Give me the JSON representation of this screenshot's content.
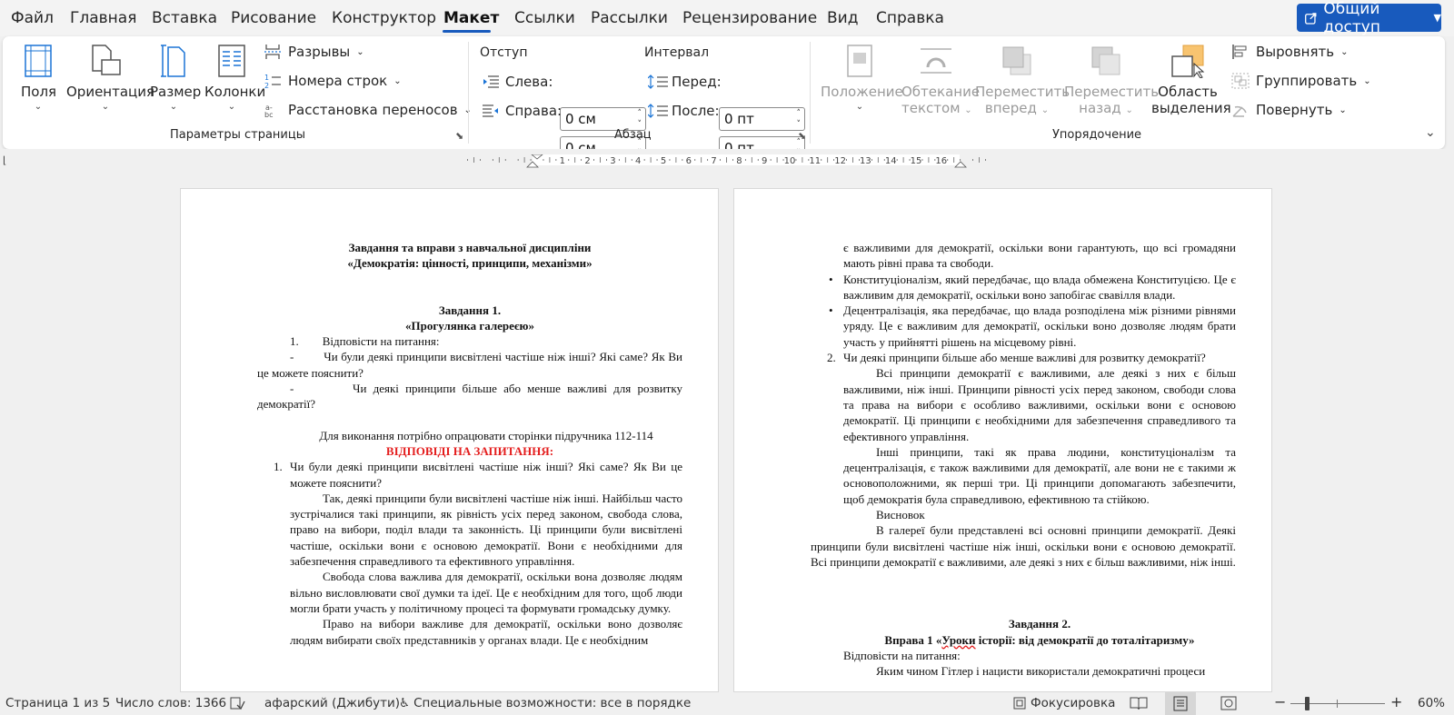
{
  "menu": {
    "tabs": [
      "Файл",
      "Главная",
      "Вставка",
      "Рисование",
      "Конструктор",
      "Макет",
      "Ссылки",
      "Рассылки",
      "Рецензирование",
      "Вид",
      "Справка"
    ],
    "active": "Макет",
    "share_label": "Общий доступ"
  },
  "ribbon": {
    "page_setup": {
      "margins": "Поля",
      "orientation": "Ориентация",
      "size": "Размер",
      "columns": "Колонки",
      "breaks": "Разрывы",
      "line_numbers": "Номера строк",
      "hyphenation": "Расстановка переносов",
      "group_label": "Параметры страницы"
    },
    "paragraph": {
      "indent_label": "Отступ",
      "spacing_label": "Интервал",
      "left_label": "Слева:",
      "left_value": "0 см",
      "right_label": "Справа:",
      "right_value": "0 см",
      "before_label": "Перед:",
      "before_value": "0 пт",
      "after_label": "После:",
      "after_value": "0 пт",
      "group_label": "Абзац"
    },
    "arrange": {
      "position": "Положение",
      "wrap_1": "Обтекание",
      "wrap_2": "текстом",
      "forward_1": "Переместить",
      "forward_2": "вперед",
      "backward_1": "Переместить",
      "backward_2": "назад",
      "selection_1": "Область",
      "selection_2": "выделения",
      "align": "Выровнять",
      "group": "Группировать",
      "rotate": "Повернуть",
      "group_label": "Упорядочение"
    }
  },
  "ruler_numbers": [
    "1",
    "2",
    "3",
    "4",
    "5",
    "6",
    "7",
    "8",
    "9",
    "10",
    "11",
    "12",
    "13",
    "14",
    "15",
    "16"
  ],
  "page1": {
    "title1": "Завдання та вправи з навчальної дисципліни",
    "title2": "«Демократія: цінності, принципи, механізми»",
    "task_title": "Завдання 1.",
    "task_sub": "«Прогулянка галереєю»",
    "item1": "1.        Відповісти на питання:",
    "dash1": "-         Чи були деякі принципи висвітлені частіше ніж інші? Які саме? Як Ви це можете пояснити?",
    "dash2": "-         Чи деякі принципи більше або менше важливі для розвитку демократії?",
    "note": "Для виконання потрібно опрацювати сторінки підручника 112-114",
    "answers_title": "ВІДПОВІДІ НА ЗАПИТАННЯ:",
    "q1_num": "1.",
    "q1": "Чи були деякі принципи висвітлені частіше ніж інші? Які саме? Як Ви це можете пояснити?",
    "p1": "Так, деякі принципи були висвітлені частіше ніж інші. Найбільш часто зустрічалися такі принципи, як рівність усіх перед законом, свобода слова, право на вибори, поділ влади та законність. Ці принципи були висвітлені частіше, оскільки вони є основою демократії. Вони є необхідними для забезпечення справедливого та ефективного управління.",
    "p2": "Свобода слова важлива для демократії, оскільки вона дозволяє людям вільно висловлювати свої думки та ідеї. Це є необхідним для того, щоб люди могли брати участь у політичному процесі та формувати громадську думку.",
    "p3": "Право на вибори важливе для демократії, оскільки воно дозволяє людям вибирати своїх представників у органах влади. Це є необхідним"
  },
  "page2": {
    "b0": "є важливими для демократії, оскільки вони гарантують, що всі громадяни мають рівні права та свободи.",
    "b1": "Конституціоналізм, який передбачає, що влада обмежена Конституцією. Це є важливим для демократії, оскільки воно запобігає свавілля влади.",
    "b2": "Децентралізація, яка передбачає, що влада розподілена між різними рівнями уряду. Це є важливим для демократії, оскільки воно дозволяє людям брати участь у прийнятті рішень на місцевому рівні.",
    "q2_num": "2.",
    "q2": "Чи деякі принципи більше або менше важливі для розвитку демократії?",
    "p1": "Всі принципи демократії є важливими, але деякі з них є більш важливими, ніж інші. Принципи рівності усіх перед законом, свободи слова та права на вибори є особливо важливими, оскільки вони є основою демократії. Ці принципи є необхідними для забезпечення справедливого та ефективного управління.",
    "p2": "Інші принципи, такі як права людини, конституціоналізм та децентралізація, є також важливими для демократії, але вони не є такими ж основоположними, як перші три. Ці принципи допомагають забезпечити, щоб демократія була справедливою, ефективною та стійкою.",
    "conclusion": "Висновок",
    "p3": "В галереї були представлені всі основні принципи демократії. Деякі принципи були висвітлені частіше ніж інші, оскільки вони є основою демократії. Всі принципи демократії є важливими, але деякі з них є більш важливими, ніж інші.",
    "task2_title": "Завдання 2.",
    "ex1_a": "Вправа 1 «",
    "ex1_b": "Уроки",
    "ex1_c": " історії: від демократії до тоталітаризму»",
    "ex1_q": "Відповісти на питання:",
    "cut": "Яким чином Гітлер і нацисти використали демократичні процеси"
  },
  "status": {
    "page": "Страница 1 из 5",
    "words": "Число слов: 1366",
    "language": "афарский (Джибути)",
    "accessibility": "Специальные возможности: все в порядке",
    "focus": "Фокусировка",
    "zoom": "60%"
  }
}
